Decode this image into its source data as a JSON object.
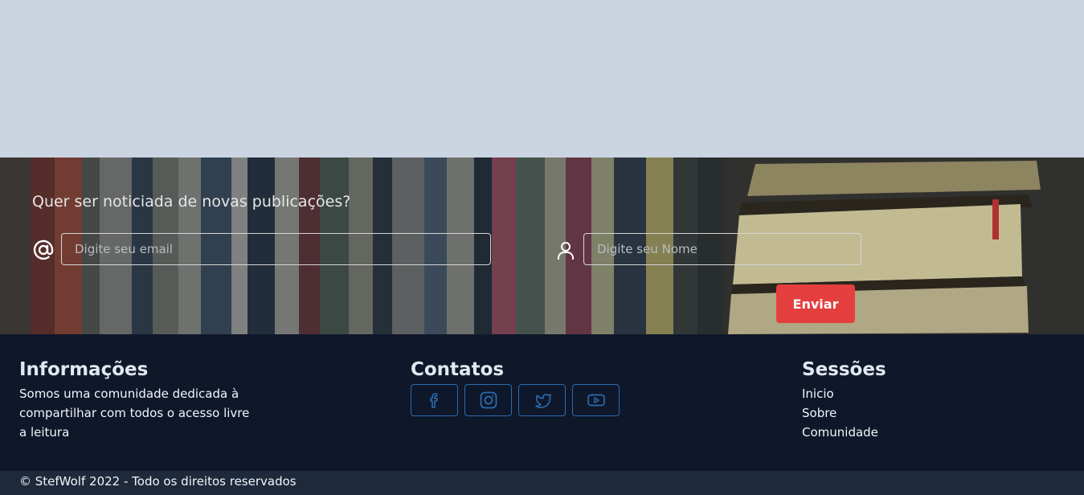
{
  "newsletter": {
    "question": "Quer ser noticiada de novas publicações?",
    "email_placeholder": "Digite seu email",
    "name_placeholder": "Digite seu Nome",
    "send_label": "Enviar",
    "icons": {
      "email": "at-sign-icon",
      "name": "user-icon"
    }
  },
  "footer": {
    "info": {
      "title": "Informações",
      "text": "Somos uma comunidade dedicada à compartilhar com todos o acesso livre a leitura"
    },
    "contacts": {
      "title": "Contatos",
      "icons": [
        "facebook-icon",
        "instagram-icon",
        "twitter-icon",
        "youtube-icon"
      ]
    },
    "sessions": {
      "title": "Sessões",
      "items": [
        "Inicio",
        "Sobre",
        "Comunidade"
      ]
    }
  },
  "copyright": "© StefWolf 2022 - Todo os direitos reservados",
  "colors": {
    "top_background": "#cbd5e1",
    "footer_background": "#0f172a",
    "copyright_background": "#1e293b",
    "send_button": "#e53e3e",
    "social_border": "#2b6cb0"
  }
}
